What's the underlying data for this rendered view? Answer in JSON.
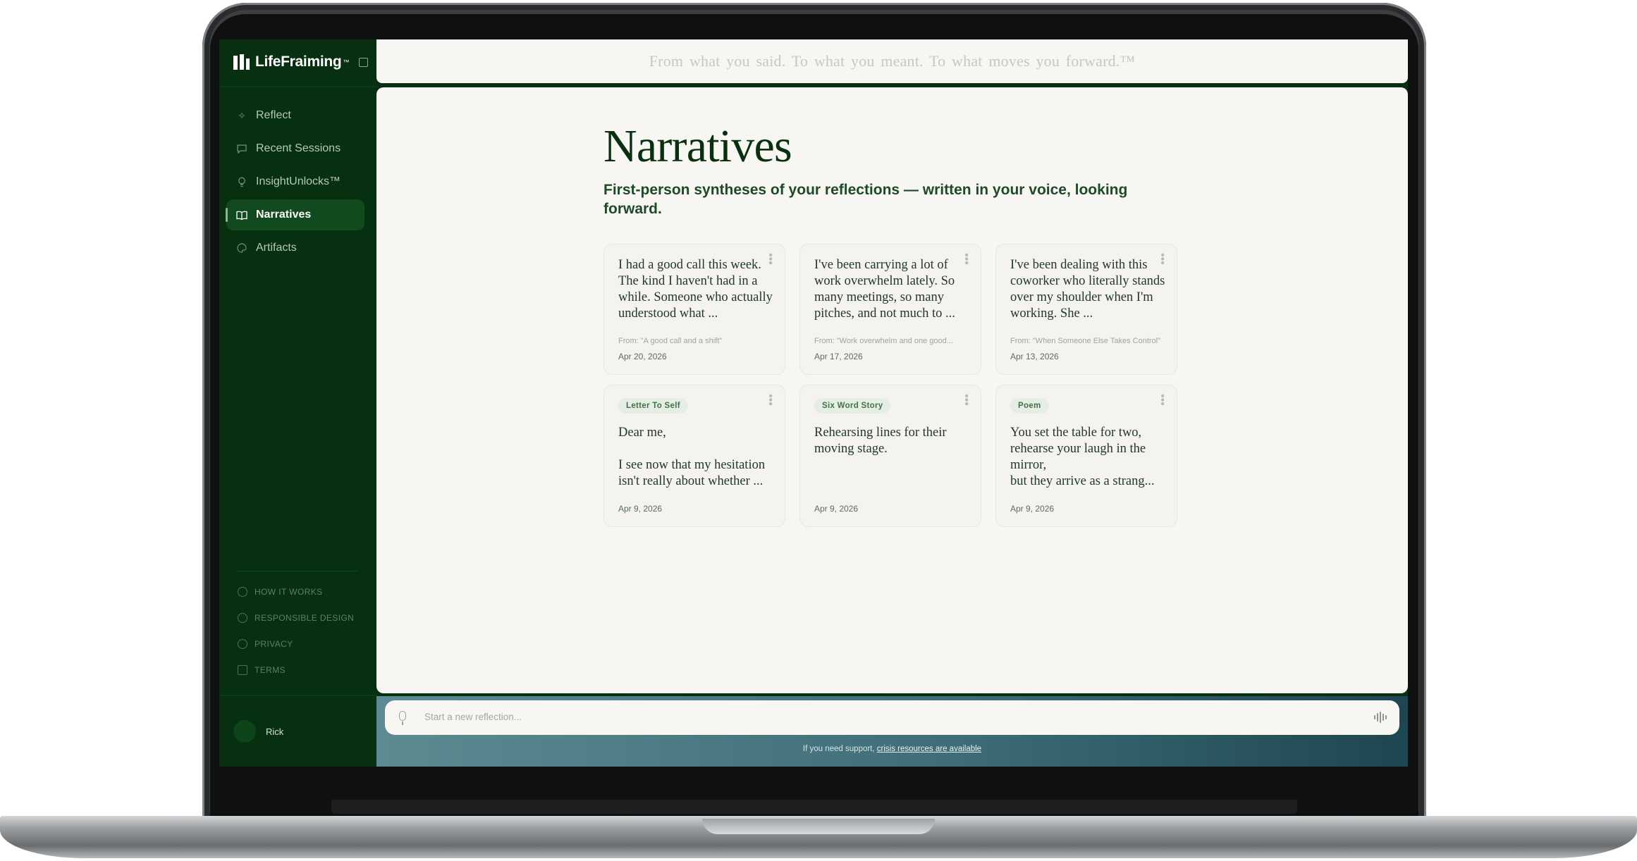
{
  "app": {
    "name": "LifeFraiming",
    "name_mark": "™",
    "tagline": "From what you said.  To what you meant.  To what moves you forward.™"
  },
  "sidebar": {
    "items": [
      {
        "label": "Reflect",
        "icon": "sparkle-icon",
        "active": false
      },
      {
        "label": "Recent Sessions",
        "icon": "chat-bubble-icon",
        "active": false
      },
      {
        "label": "InsightUnlocks™",
        "icon": "lightbulb-icon",
        "active": false
      },
      {
        "label": "Narratives",
        "icon": "open-book-icon",
        "active": true
      },
      {
        "label": "Artifacts",
        "icon": "palette-icon",
        "active": false
      }
    ],
    "footer_links": [
      {
        "label": "HOW IT WORKS",
        "icon": "help-circle-icon"
      },
      {
        "label": "RESPONSIBLE DESIGN",
        "icon": "shield-icon"
      },
      {
        "label": "PRIVACY",
        "icon": "lock-shield-icon"
      },
      {
        "label": "TERMS",
        "icon": "document-icon"
      }
    ],
    "user": {
      "name": "Rick"
    }
  },
  "page": {
    "title": "Narratives",
    "subtitle": "First-person syntheses of your reflections — written in your voice, looking forward."
  },
  "cards": [
    {
      "badge": "",
      "text": "I had a good call this week. The kind I haven't had in a while. Someone who actually understood what ...",
      "source": "From: \"A good call and a shift\"",
      "date": "Apr 20, 2026"
    },
    {
      "badge": "",
      "text": "I've been carrying a lot of work overwhelm lately. So many meetings, so many pitches, and not much to ...",
      "source": "From: \"Work overwhelm and one good...",
      "date": "Apr 17, 2026"
    },
    {
      "badge": "",
      "text": "I've been dealing with this coworker who literally stands over my shoulder when I'm working. She ...",
      "source": "From: \"When Someone Else Takes Control\"",
      "date": "Apr 13, 2026"
    },
    {
      "badge": "Letter To Self",
      "text": "Dear me,\n\nI see now that my hesitation isn't really about whether ...",
      "source": "",
      "date": "Apr 9, 2026"
    },
    {
      "badge": "Six Word Story",
      "text": "Rehearsing lines for their moving stage.",
      "source": "",
      "date": "Apr 9, 2026"
    },
    {
      "badge": "Poem",
      "text": "You set the table for two,\nrehearse your laugh in the mirror,\nbut they arrive as a strang...",
      "source": "",
      "date": "Apr 9, 2026"
    }
  ],
  "composer": {
    "placeholder": "Start a new reflection...",
    "support_prefix": "If you need support, ",
    "support_link": "crisis resources are available"
  },
  "colors": {
    "sidebar_bg": "#06300f",
    "active_item_bg": "#114a1e",
    "title": "#08300f",
    "panel_bg": "#f7f6f3",
    "badge_bg": "#e6ede5"
  }
}
